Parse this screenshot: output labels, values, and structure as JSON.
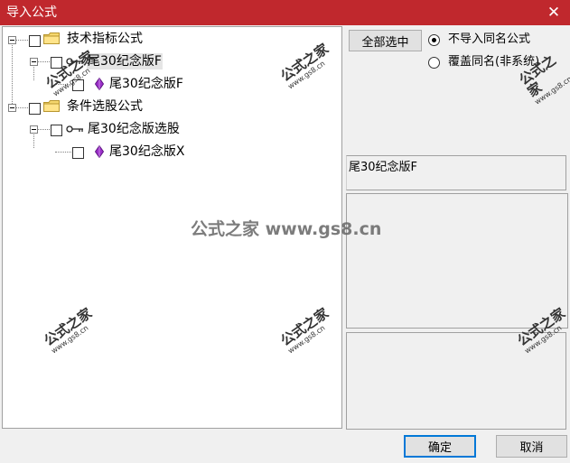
{
  "window": {
    "title": "导入公式",
    "close_glyph": "✕"
  },
  "tree": {
    "nodes": [
      {
        "label": "技术指标公式"
      },
      {
        "label": "尾30纪念版F"
      },
      {
        "label": "尾30纪念版F"
      },
      {
        "label": "条件选股公式"
      },
      {
        "label": "尾30纪念版选股"
      },
      {
        "label": "尾30纪念版X"
      }
    ]
  },
  "select_all_label": "全部选中",
  "options": [
    {
      "label": "不导入同名公式",
      "selected": true
    },
    {
      "label": "覆盖同名(非系统)",
      "selected": false
    }
  ],
  "formula_name": "尾30纪念版F",
  "buttons": {
    "ok": "确定",
    "cancel": "取消"
  },
  "watermark": {
    "brand": "公式之家",
    "url": "www.gs8.cn",
    "center": "公式之家 www.gs8.cn"
  },
  "colors": {
    "titlebar": "#c0282d",
    "folder": "#f5d76e",
    "gem": "#9b2fc9"
  },
  "icons": [
    "folder-icon",
    "key-icon",
    "gem-icon",
    "close-icon"
  ]
}
